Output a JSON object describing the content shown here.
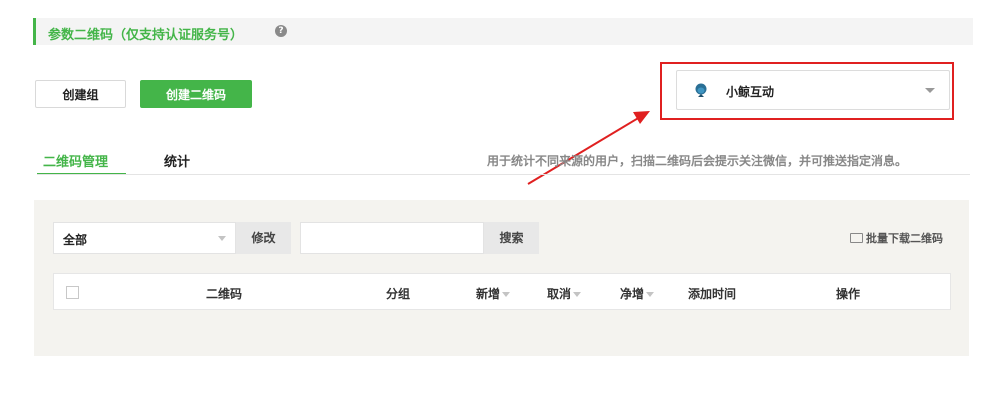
{
  "header": {
    "title": "参数二维码（仅支持认证服务号）",
    "help_icon": "?"
  },
  "toolbar": {
    "create_group_label": "创建组",
    "create_qrcode_label": "创建二维码"
  },
  "account": {
    "name": "小鲸互动",
    "avatar_icon": "whale-logo-icon"
  },
  "tabs": [
    {
      "label": "二维码管理",
      "active": true
    },
    {
      "label": "统计",
      "active": false
    }
  ],
  "tab_description": "用于统计不同来源的用户，扫描二维码后会提示关注微信，并可推送指定消息。",
  "filter": {
    "selected": "全部",
    "edit_label": "修改",
    "search_placeholder": "",
    "search_label": "搜索"
  },
  "batch_download_label": "批量下载二维码",
  "table": {
    "columns": [
      "二维码",
      "分组",
      "新增",
      "取消",
      "净增",
      "添加时间",
      "操作"
    ]
  },
  "colors": {
    "accent": "#44b549",
    "annotation": "#e02020"
  }
}
